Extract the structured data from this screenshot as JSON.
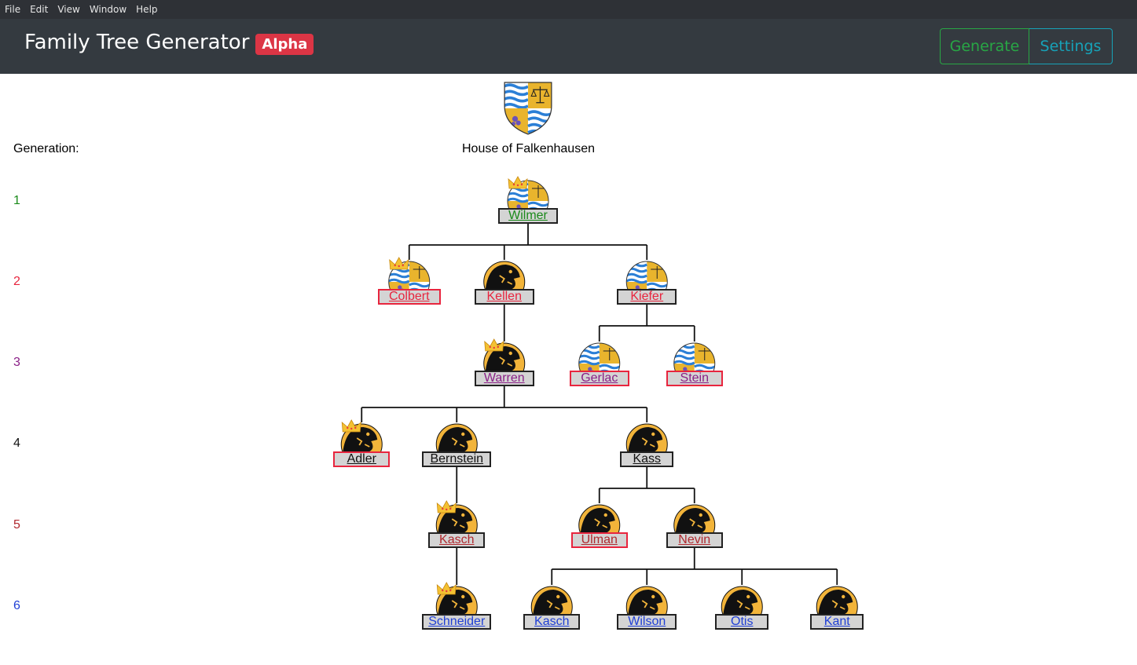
{
  "menu": [
    "File",
    "Edit",
    "View",
    "Window",
    "Help"
  ],
  "app": {
    "title": "Family Tree Generator",
    "badge": "Alpha"
  },
  "buttons": {
    "generate": "Generate",
    "settings": "Settings"
  },
  "colors": {
    "navbar": "#343a40",
    "badge": "#dc3545",
    "generate": "#28a745",
    "settings": "#17a2b8"
  },
  "generation_label": "Generation:",
  "house_name": "House of Falkenhausen",
  "generations": [
    {
      "num": "1",
      "color": "#1a8a1a"
    },
    {
      "num": "2",
      "color": "#e8253e"
    },
    {
      "num": "3",
      "color": "#8a1f87"
    },
    {
      "num": "4",
      "color": "#111111"
    },
    {
      "num": "5",
      "color": "#b0282e"
    },
    {
      "num": "6",
      "color": "#1f3fd6"
    }
  ],
  "people": [
    {
      "name": "Wilmer",
      "gen": 1,
      "crest": "waves",
      "crowned": true,
      "spouse": false
    },
    {
      "name": "Colbert",
      "gen": 2,
      "crest": "waves",
      "crowned": true,
      "spouse": true
    },
    {
      "name": "Kellen",
      "gen": 2,
      "crest": "lion",
      "crowned": false,
      "spouse": false
    },
    {
      "name": "Kiefer",
      "gen": 2,
      "crest": "waves",
      "crowned": false,
      "spouse": false
    },
    {
      "name": "Warren",
      "gen": 3,
      "crest": "lion",
      "crowned": true,
      "spouse": false
    },
    {
      "name": "Gerlac",
      "gen": 3,
      "crest": "waves",
      "crowned": false,
      "spouse": true
    },
    {
      "name": "Stein",
      "gen": 3,
      "crest": "waves",
      "crowned": false,
      "spouse": true
    },
    {
      "name": "Adler",
      "gen": 4,
      "crest": "lion",
      "crowned": true,
      "spouse": true
    },
    {
      "name": "Bernstein",
      "gen": 4,
      "crest": "lion",
      "crowned": false,
      "spouse": false
    },
    {
      "name": "Kass",
      "gen": 4,
      "crest": "lion",
      "crowned": false,
      "spouse": false
    },
    {
      "name": "Kasch",
      "gen": 5,
      "crest": "lion",
      "crowned": true,
      "spouse": false
    },
    {
      "name": "Ulman",
      "gen": 5,
      "crest": "lion",
      "crowned": false,
      "spouse": true
    },
    {
      "name": "Nevin",
      "gen": 5,
      "crest": "lion",
      "crowned": false,
      "spouse": false
    },
    {
      "name": "Schneider",
      "gen": 6,
      "crest": "lion",
      "crowned": true,
      "spouse": false
    },
    {
      "name": "Kasch",
      "gen": 6,
      "crest": "lion",
      "crowned": false,
      "spouse": false
    },
    {
      "name": "Wilson",
      "gen": 6,
      "crest": "lion",
      "crowned": false,
      "spouse": false
    },
    {
      "name": "Otis",
      "gen": 6,
      "crest": "lion",
      "crowned": false,
      "spouse": false
    },
    {
      "name": "Kant",
      "gen": 6,
      "crest": "lion",
      "crowned": false,
      "spouse": false
    }
  ],
  "relations": [
    {
      "parent": "Wilmer",
      "children": [
        "Colbert",
        "Kellen",
        "Kiefer"
      ]
    },
    {
      "parent": "Kellen",
      "children": [
        "Warren"
      ]
    },
    {
      "parent": "Kiefer",
      "children": [
        "Gerlac",
        "Stein"
      ]
    },
    {
      "parent": "Warren",
      "children": [
        "Adler",
        "Bernstein",
        "Kass"
      ]
    },
    {
      "parent": "Bernstein",
      "children": [
        "Kasch"
      ]
    },
    {
      "parent": "Kass",
      "children": [
        "Ulman",
        "Nevin"
      ]
    },
    {
      "parent": "Kasch",
      "children": [
        "Schneider"
      ]
    },
    {
      "parent": "Nevin",
      "children": [
        "Kasch",
        "Wilson",
        "Otis",
        "Kant"
      ]
    }
  ]
}
